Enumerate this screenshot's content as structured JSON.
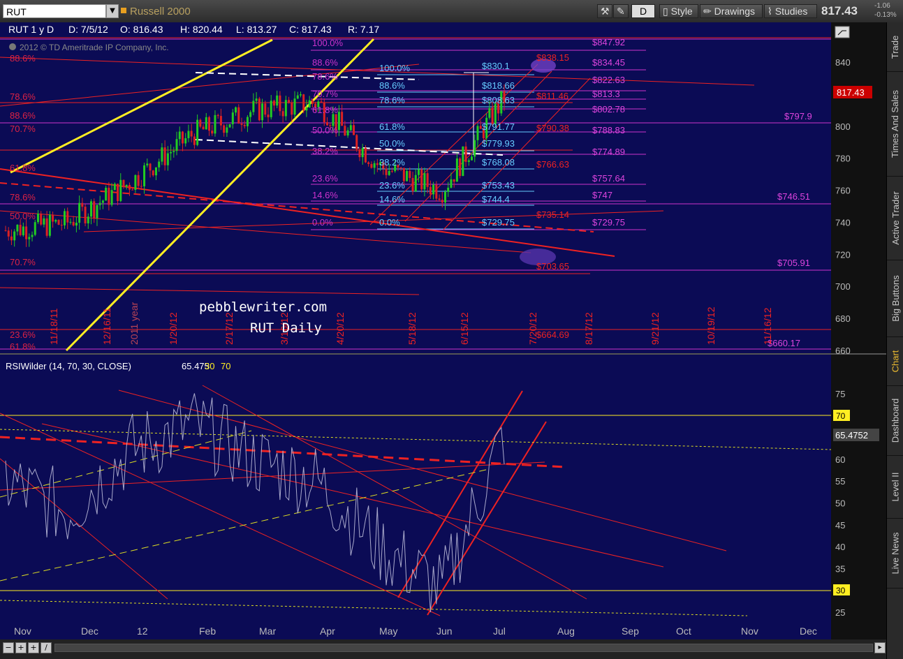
{
  "toolbar": {
    "symbol": "RUT",
    "symbol_name": "Russell 2000",
    "d_label": "D",
    "style_label": "Style",
    "drawings_label": "Drawings",
    "studies_label": "Studies",
    "last_price": "817.43",
    "change": "-1.06",
    "change_pct": "-0.13%"
  },
  "sidebar": {
    "tabs": [
      {
        "label": "Trade",
        "active": false
      },
      {
        "label": "Times And Sales",
        "active": false
      },
      {
        "label": "Active Trader",
        "active": false
      },
      {
        "label": "Big Buttons",
        "active": false
      },
      {
        "label": "Chart",
        "active": true
      },
      {
        "label": "Dashboard",
        "active": false
      },
      {
        "label": "Level II",
        "active": false
      },
      {
        "label": "Live News",
        "active": false
      }
    ]
  },
  "header": {
    "info": "RUT 1 y D",
    "d": "D: 7/5/12",
    "o": "O: 816.43",
    "h": "H: 820.44",
    "l": "L: 813.27",
    "c": "C: 817.43",
    "r": "R: 7.17",
    "copyright": "2012 © TD Ameritrade IP Company, Inc."
  },
  "watermark": {
    "line1": "pebblewriter.com",
    "line2": "RUT Daily"
  },
  "price_axis": {
    "ticks": [
      "840",
      "820",
      "800",
      "780",
      "760",
      "740",
      "720",
      "700",
      "680",
      "660"
    ],
    "last_label": "817.43"
  },
  "fib_left": [
    "88.6%",
    "78.6%",
    "88.6%",
    "70.7%",
    "61.8%",
    "78.6%",
    "50.0%",
    "70.7%",
    "23.6%",
    "61.8%"
  ],
  "fib_mid": [
    "100.0%",
    "88.6%",
    "78.6%",
    "70.7%",
    "61.8%",
    "50.0%",
    "38.2%",
    "23.6%",
    "14.6%",
    "0.0%"
  ],
  "fib_inner": [
    "100.0%",
    "88.6%",
    "78.6%",
    "61.8%",
    "50.0%",
    "38.2%",
    "23.6%",
    "14.6%",
    "0.0%"
  ],
  "fib_inner_prices": [
    "$830.1",
    "$818.66",
    "$808.63",
    "$791.77",
    "$779.93",
    "$768.08",
    "$753.43",
    "$744.4",
    "$729.75"
  ],
  "red_prices": [
    "$838.15",
    "$811.46",
    "$790.38",
    "$766.63",
    "$735.14",
    "$703.65",
    "$664.69"
  ],
  "magenta_prices": [
    "$847.92",
    "$834.45",
    "$822.63",
    "$813.3",
    "$802.78",
    "$788.83",
    "$774.89",
    "$757.64",
    "$747",
    "$729.75"
  ],
  "far_prices": [
    "$797.9",
    "$746.51",
    "$705.91",
    "$660.17"
  ],
  "date_labels": [
    "11/18/11",
    "12/16/11",
    "2011 year",
    "1/20/12",
    "2/17/12",
    "3/16/12",
    "4/20/12",
    "5/18/12",
    "6/15/12",
    "7/20/12",
    "8/17/12",
    "9/21/12",
    "10/19/12",
    "11/16/12"
  ],
  "rsi": {
    "header": "RSIWilder (14, 70, 30, CLOSE)",
    "value": "65.475",
    "ob": "30",
    "os": "70",
    "ticks": [
      "75",
      "70",
      "65",
      "60",
      "55",
      "50",
      "45",
      "40",
      "35",
      "30",
      "25"
    ],
    "last_label": "65.4752",
    "level70": "70",
    "level30": "30"
  },
  "x_axis": [
    "Nov",
    "Dec",
    "12",
    "Feb",
    "Mar",
    "Apr",
    "May",
    "Jun",
    "Jul",
    "Aug",
    "Sep",
    "Oct",
    "Nov",
    "Dec"
  ],
  "colors": {
    "bg": "#0b0b55",
    "up": "#22cc22",
    "down": "#dd2222",
    "fib_magenta": "#cc33cc",
    "fib_cyan": "#66ccff",
    "trend_red": "#ee2222",
    "yellow": "#ffee22"
  },
  "chart_data": {
    "type": "candlestick",
    "title": "RUT Daily",
    "ylim": [
      655,
      855
    ],
    "x": [
      "Nov",
      "Dec",
      "12",
      "Feb",
      "Mar",
      "Apr",
      "May",
      "Jun",
      "Jul"
    ],
    "close": [
      735,
      740,
      765,
      795,
      810,
      815,
      775,
      760,
      817.43
    ],
    "rsi_ylim": [
      24,
      78
    ],
    "rsi": [
      55,
      48,
      62,
      68,
      60,
      55,
      40,
      30,
      65.475
    ]
  }
}
